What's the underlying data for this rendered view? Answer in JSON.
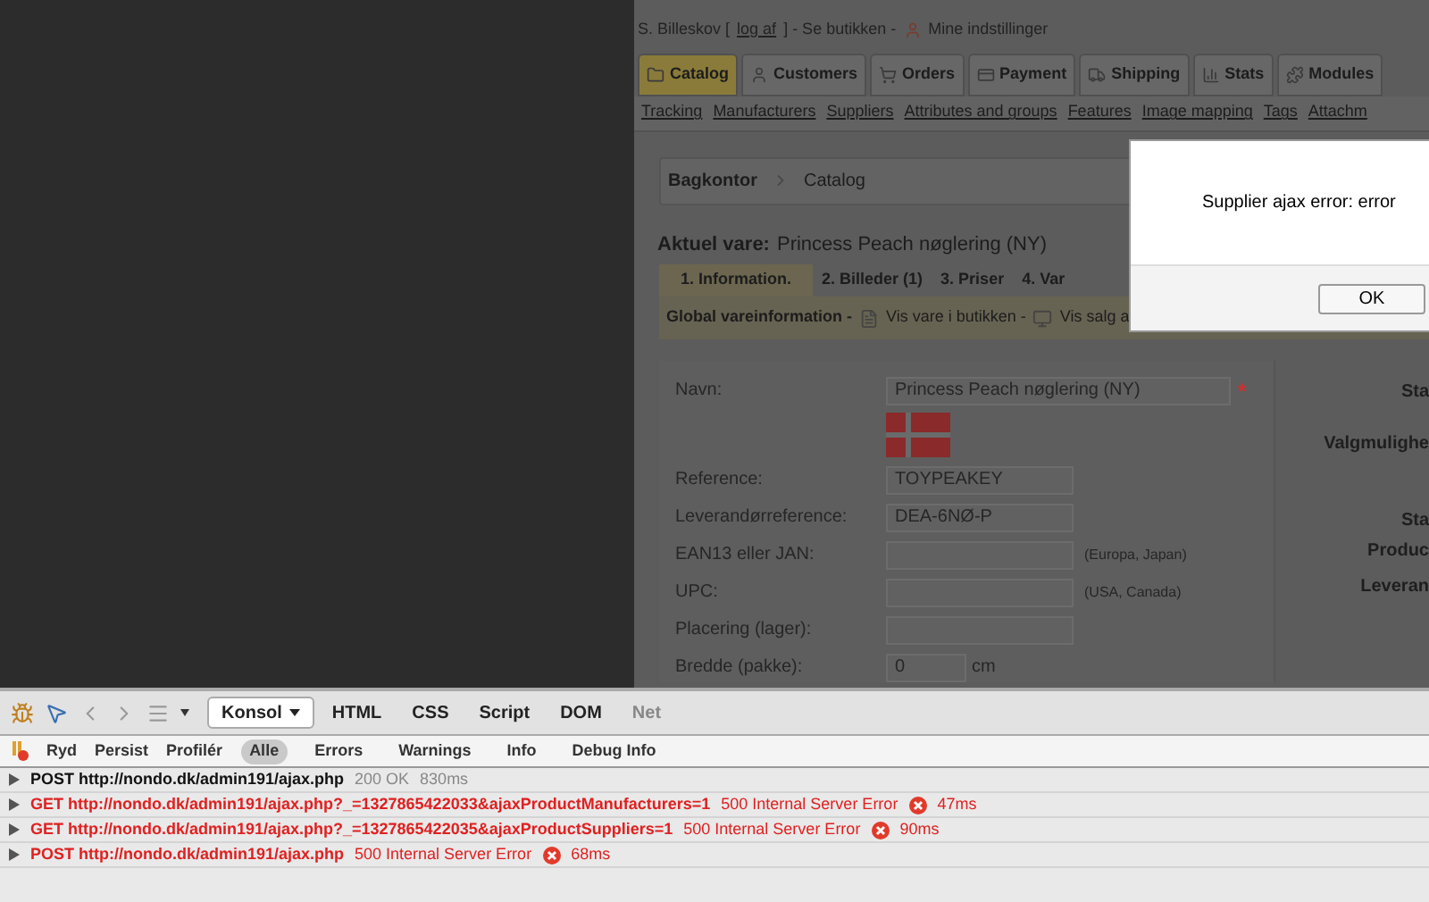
{
  "user_bar": {
    "name": "S. Billeskov [",
    "logout": "log af",
    "shop": "] - Se butikken -",
    "settings": "Mine indstillinger"
  },
  "main_tabs": [
    {
      "label": "Catalog",
      "selected": true
    },
    {
      "label": "Customers",
      "selected": false
    },
    {
      "label": "Orders",
      "selected": false
    },
    {
      "label": "Payment",
      "selected": false
    },
    {
      "label": "Shipping",
      "selected": false
    },
    {
      "label": "Stats",
      "selected": false
    },
    {
      "label": "Modules",
      "selected": false
    }
  ],
  "sub_nav": [
    "Tracking",
    "Manufacturers",
    "Suppliers",
    "Attributes and groups",
    "Features",
    "Image mapping",
    "Tags",
    "Attachm"
  ],
  "breadcrumb": [
    "Bagkontor",
    "Catalog"
  ],
  "current_item": {
    "label": "Aktuel vare:",
    "value": "Princess Peach nøglering (NY)"
  },
  "product_tabs": [
    {
      "label": "1. Information.",
      "selected": true
    },
    {
      "label": "2. Billeder (1)",
      "selected": false
    },
    {
      "label": "3. Priser",
      "selected": false
    },
    {
      "label": "4. Var",
      "selected": false
    }
  ],
  "global_info": {
    "title": "Global vareinformation -",
    "links": [
      "Vis vare i butikken -",
      "Vis salg a"
    ]
  },
  "form": [
    {
      "kind": "text",
      "label": "Navn:",
      "value": "Princess Peach nøglering (NY)",
      "required_mark": "*"
    },
    {
      "kind": "flag"
    },
    {
      "kind": "text",
      "label": "Reference:",
      "value": "TOYPEAKEY"
    },
    {
      "kind": "text",
      "label": "Leverandørreference:",
      "value": "DEA-6NØ-P"
    },
    {
      "kind": "text",
      "label": "EAN13 eller JAN:",
      "hint": "(Europa, Japan)"
    },
    {
      "kind": "text",
      "label": "UPC:",
      "hint": "(USA, Canada)"
    },
    {
      "kind": "text",
      "label": "Placering (lager):"
    },
    {
      "kind": "unit",
      "label": "Bredde (pakke):",
      "value": "0",
      "unit": "cm"
    }
  ],
  "right_labels": [
    "Sta",
    "Valgmulighe",
    "Sta",
    "Produc",
    "Leveran"
  ],
  "dialog": {
    "message": "Supplier ajax error: error",
    "button": "OK"
  },
  "devtools": {
    "tabs": [
      {
        "label": "Konsol",
        "selected": true,
        "disabled": false
      },
      {
        "label": "HTML",
        "selected": false,
        "disabled": false
      },
      {
        "label": "CSS",
        "selected": false,
        "disabled": false
      },
      {
        "label": "Script",
        "selected": false,
        "disabled": false
      },
      {
        "label": "DOM",
        "selected": false,
        "disabled": false
      },
      {
        "label": "Net",
        "selected": false,
        "disabled": true
      }
    ],
    "actions": [
      "Ryd",
      "Persist",
      "Profilér"
    ],
    "filters": [
      {
        "label": "Alle",
        "selected": true
      },
      {
        "label": "Errors",
        "selected": false
      },
      {
        "label": "Warnings",
        "selected": false
      },
      {
        "label": "Info",
        "selected": false
      },
      {
        "label": "Debug Info",
        "selected": false
      }
    ],
    "log": [
      {
        "request": "POST http://nondo.dk/admin191/ajax.php",
        "status": "200 OK",
        "time": "830ms",
        "error": false
      },
      {
        "request": "GET http://nondo.dk/admin191/ajax.php?_=1327865422033&ajaxProductManufacturers=1",
        "status": "500 Internal Server Error",
        "time": "47ms",
        "error": true
      },
      {
        "request": "GET http://nondo.dk/admin191/ajax.php?_=1327865422035&ajaxProductSuppliers=1",
        "status": "500 Internal Server Error",
        "time": "90ms",
        "error": true
      },
      {
        "request": "POST http://nondo.dk/admin191/ajax.php",
        "status": "500 Internal Server Error",
        "time": "68ms",
        "error": true
      }
    ]
  }
}
